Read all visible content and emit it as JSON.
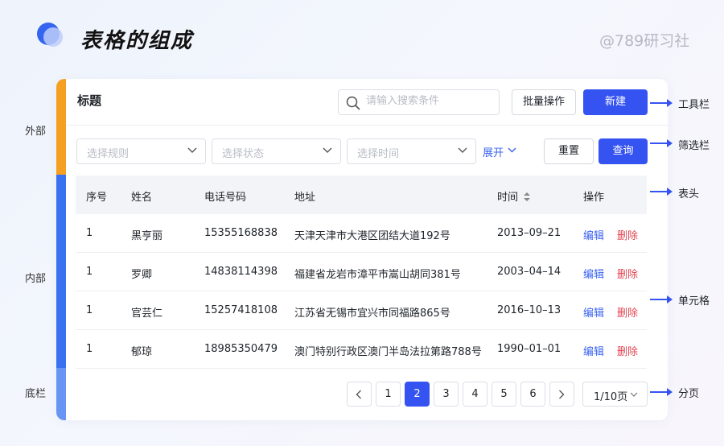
{
  "header": {
    "title": "表格的组成",
    "watermark": "@789研习社"
  },
  "side_labels": {
    "outer": "外部",
    "inner": "内部",
    "footer": "底栏"
  },
  "toolbar": {
    "title": "标题",
    "search_placeholder": "请输入搜索条件",
    "batch_label": "批量操作",
    "new_label": "新建"
  },
  "filter": {
    "rule_placeholder": "选择规则",
    "status_placeholder": "选择状态",
    "time_placeholder": "选择时间",
    "expand_label": "展开",
    "reset_label": "重置",
    "query_label": "查询"
  },
  "table": {
    "headers": [
      "序号",
      "姓名",
      "电话号码",
      "地址",
      "时间",
      "操作"
    ],
    "edit_label": "编辑",
    "delete_label": "删除",
    "rows": [
      {
        "no": "1",
        "name": "黑亨丽",
        "phone": "15355168838",
        "address": "天津天津市大港区团结大道192号",
        "time": "2013–09–21"
      },
      {
        "no": "1",
        "name": "罗卿",
        "phone": "14838114398",
        "address": "福建省龙岩市漳平市嵩山胡同381号",
        "time": "2003–04–14"
      },
      {
        "no": "1",
        "name": "官芸仁",
        "phone": "15257418108",
        "address": "江苏省无锡市宜兴市同福路865号",
        "time": "2016–10–13"
      },
      {
        "no": "1",
        "name": "郁琼",
        "phone": "18985350479",
        "address": "澳门特别行政区澳门半岛法拉第路788号",
        "time": "1990–01–01"
      }
    ]
  },
  "pagination": {
    "pages": [
      "1",
      "2",
      "3",
      "4",
      "5",
      "6"
    ],
    "current": "2",
    "page_size": "1/10页"
  },
  "annotations": {
    "toolbar": "工具栏",
    "filter": "筛选栏",
    "header": "表头",
    "cell": "单元格",
    "pagination": "分页"
  },
  "colors": {
    "primary": "#3553f1",
    "outer_stripe": "#f5a021",
    "inner_stripe": "#3a71f0",
    "footer_stripe": "#6895f3",
    "danger": "#e0424f"
  }
}
